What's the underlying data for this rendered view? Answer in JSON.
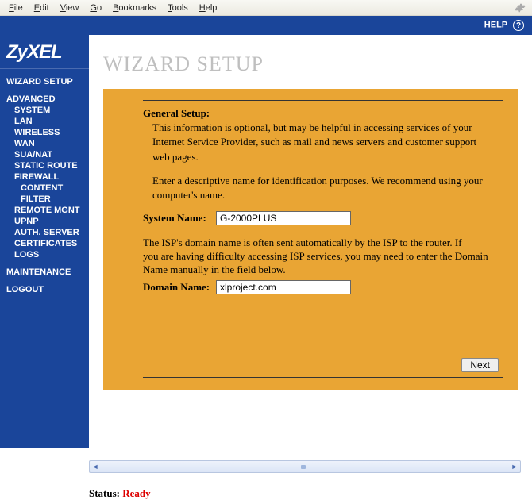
{
  "menubar": {
    "items": [
      "File",
      "Edit",
      "View",
      "Go",
      "Bookmarks",
      "Tools",
      "Help"
    ]
  },
  "header": {
    "help_label": "HELP",
    "help_icon": "?"
  },
  "sidebar": {
    "logo": "ZyXEL",
    "wizard": "WIZARD SETUP",
    "advanced": "ADVANCED",
    "advanced_items": [
      "SYSTEM",
      "LAN",
      "WIRELESS",
      "WAN",
      "SUA/NAT",
      "STATIC ROUTE",
      "FIREWALL"
    ],
    "firewall_items": [
      "CONTENT",
      "FILTER"
    ],
    "advanced_items2": [
      "REMOTE MGNT",
      "UPNP",
      "AUTH. SERVER",
      "CERTIFICATES",
      "LOGS"
    ],
    "maintenance": "MAINTENANCE",
    "logout": "LOGOUT"
  },
  "page": {
    "title": "WIZARD SETUP",
    "general_setup_label": "General Setup:",
    "info1": "This information is optional, but may be helpful in accessing services of your",
    "info2": "Internet Service Provider, such as mail and news servers and customer support",
    "info3": "web pages.",
    "info4": "Enter a descriptive name for identification purposes. We recommend using your",
    "info5": "computer's name.",
    "system_name_label": "System Name:",
    "system_name_value": "G-2000PLUS",
    "isp_note1": "The ISP's domain name is often sent automatically by the ISP to the router. If",
    "isp_note2": "you are having difficulty accessing ISP services, you may need to enter the Domain Name manually in the field below.",
    "domain_name_label": "Domain Name:",
    "domain_name_value": "xlproject.com",
    "next_button": "Next"
  },
  "status": {
    "label": "Status:",
    "value": "Ready"
  }
}
